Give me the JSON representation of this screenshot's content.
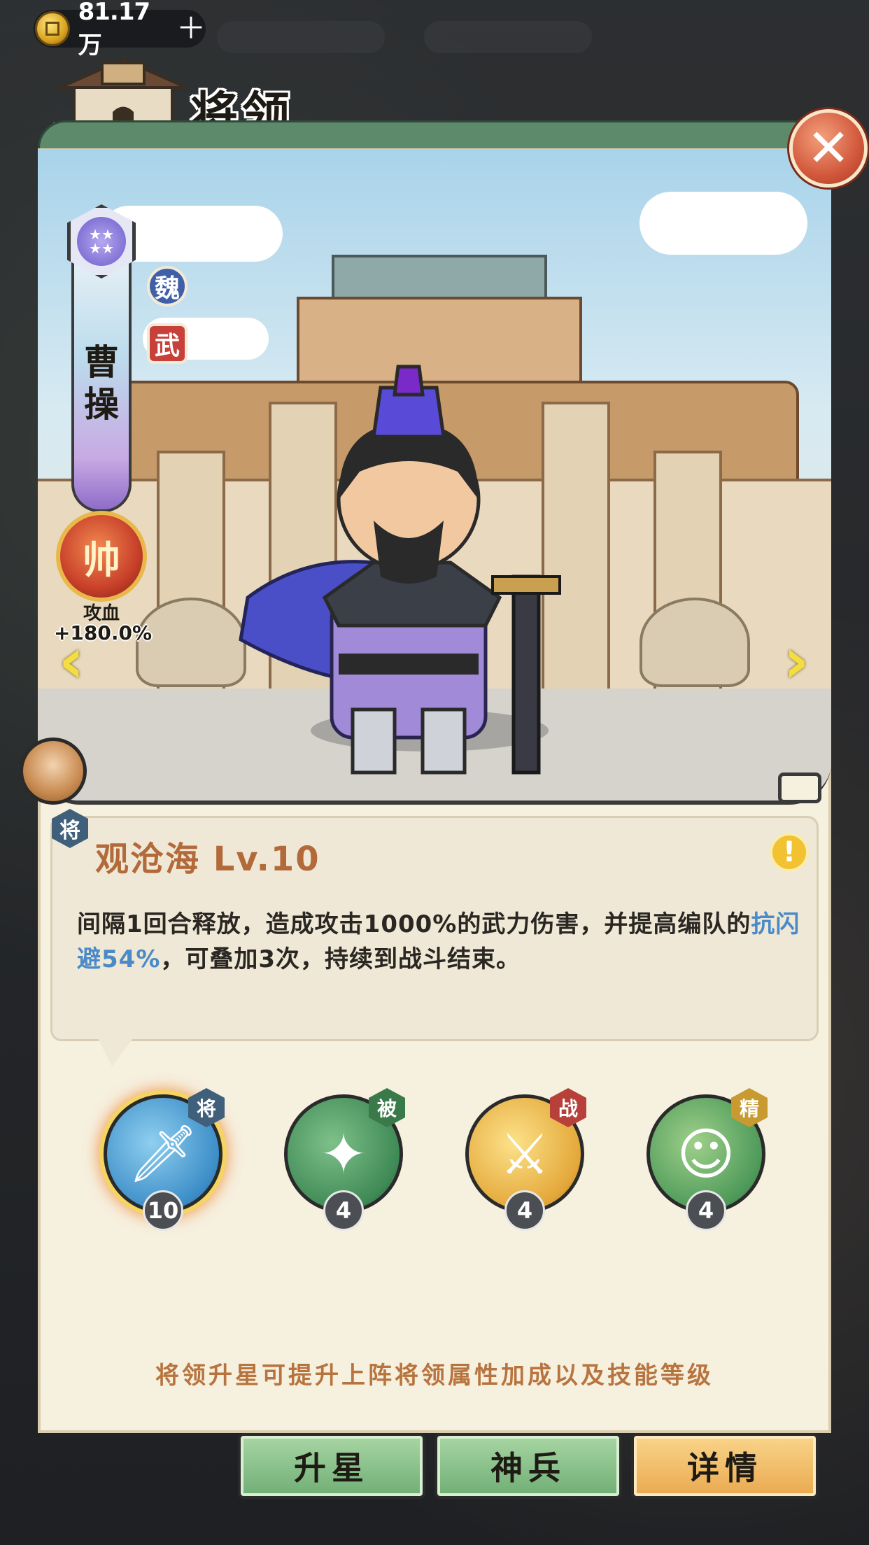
{
  "resources": {
    "coins": "81.17万",
    "add_label": "＋"
  },
  "header": {
    "title": "将领",
    "close_label": "✕"
  },
  "general": {
    "name": [
      "曹",
      "操"
    ],
    "stars": 4,
    "faction": "魏",
    "type": "武",
    "commander": {
      "label": "帅",
      "attr": "攻血",
      "bonus": "+180.0%"
    }
  },
  "nav": {
    "prev": "‹",
    "next": "›"
  },
  "skill": {
    "type_badge": "将",
    "title": "观沧海 Lv.10",
    "info_label": "!",
    "desc_before": "间隔1回合释放，造成攻击1000%的武力伤害，并提高编队的",
    "desc_highlight": "抗闪避54%",
    "desc_after": "，可叠加3次，持续到战斗结束。"
  },
  "skills": [
    {
      "badge": "将",
      "badge_color": "#3f5f7a",
      "level": "10",
      "icon": "blade-icon",
      "active": true
    },
    {
      "badge": "被",
      "badge_color": "#3a7a4a",
      "level": "4",
      "icon": "club-icon",
      "active": false
    },
    {
      "badge": "战",
      "badge_color": "#b8403a",
      "level": "4",
      "icon": "sword-slash-icon",
      "active": false
    },
    {
      "badge": "精",
      "badge_color": "#c89a30",
      "level": "4",
      "icon": "cheer-icon",
      "active": false
    }
  ],
  "hint": "将领升星可提升上阵将领属性加成以及技能等级",
  "tabs": [
    {
      "label": "升星",
      "selected": false
    },
    {
      "label": "神兵",
      "selected": false
    },
    {
      "label": "详情",
      "selected": true
    }
  ]
}
